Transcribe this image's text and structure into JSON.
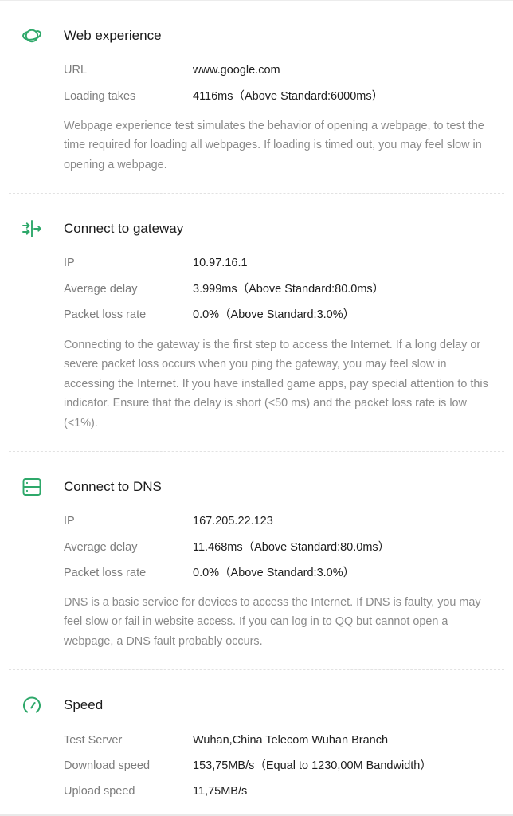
{
  "accent_color": "#2ea86a",
  "sections": [
    {
      "icon": "planet-icon",
      "title": "Web experience",
      "rows": [
        {
          "label": "URL",
          "value": "www.google.com"
        },
        {
          "label": "Loading takes",
          "value": "4116ms（Above Standard:6000ms）"
        }
      ],
      "description": "Webpage experience test simulates the behavior of opening a webpage, to test the time required for loading all webpages. If loading is timed out, you may feel slow in opening a webpage."
    },
    {
      "icon": "gateway-arrows-icon",
      "title": "Connect to gateway",
      "rows": [
        {
          "label": "IP",
          "value": "10.97.16.1"
        },
        {
          "label": "Average delay",
          "value": "3.999ms（Above Standard:80.0ms）"
        },
        {
          "label": "Packet loss rate",
          "value": "0.0%（Above Standard:3.0%）"
        }
      ],
      "description": "Connecting to the gateway is the first step to access the Internet. If a long delay or severe packet loss occurs when you ping the gateway, you may feel slow in accessing the Internet. If you have installed game apps, pay special attention to this indicator. Ensure that the delay is short (<50 ms) and the packet loss rate is low (<1%)."
    },
    {
      "icon": "server-icon",
      "title": "Connect to DNS",
      "rows": [
        {
          "label": "IP",
          "value": "167.205.22.123"
        },
        {
          "label": "Average delay",
          "value": "11.468ms（Above Standard:80.0ms）"
        },
        {
          "label": "Packet loss rate",
          "value": "0.0%（Above Standard:3.0%）"
        }
      ],
      "description": "DNS is a basic service for devices to access the Internet. If DNS is faulty, you may feel slow or fail in website access. If you can log in to QQ but cannot open a webpage, a DNS fault probably occurs."
    },
    {
      "icon": "speedometer-icon",
      "title": "Speed",
      "rows": [
        {
          "label": "Test Server",
          "value": "Wuhan,China Telecom Wuhan Branch"
        },
        {
          "label": "Download speed",
          "value": "153,75MB/s（Equal to 1230,00M Bandwidth）"
        },
        {
          "label": "Upload speed",
          "value": "11,75MB/s"
        }
      ]
    }
  ]
}
